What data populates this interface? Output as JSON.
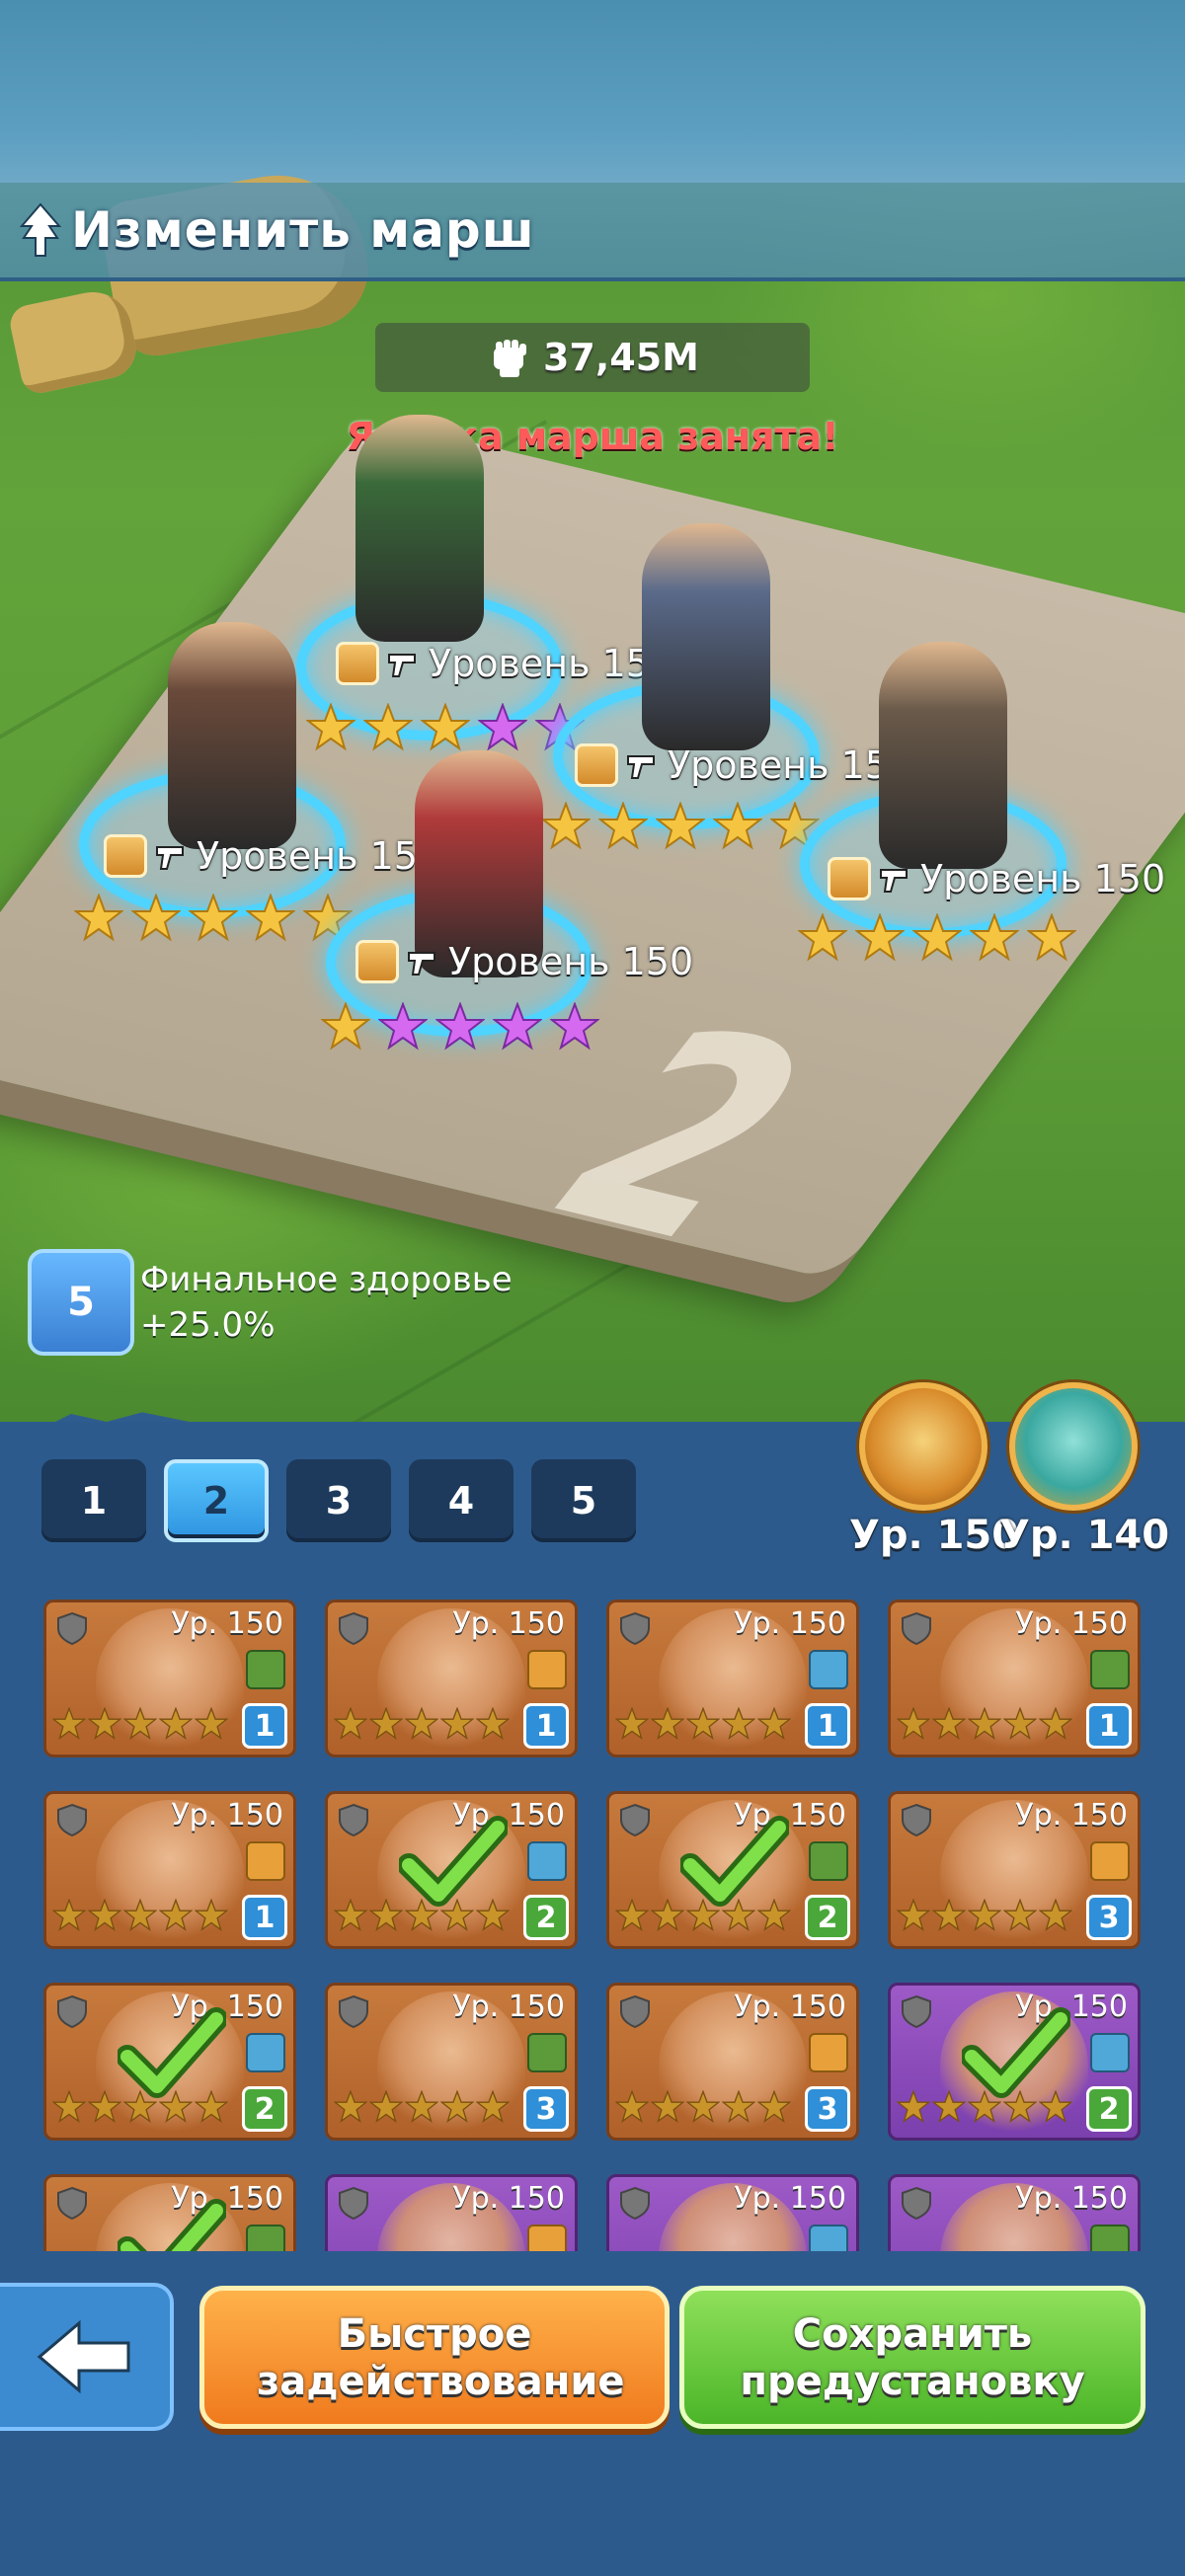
{
  "header": {
    "title": "Изменить марш",
    "power": "37,45M",
    "warning": "Ячейка марша занята!"
  },
  "formation": {
    "heroes": [
      {
        "level": "Уровень 150",
        "gold_stars": 3,
        "purple_stars": 2
      },
      {
        "level": "Уровень 150",
        "gold_stars": 5,
        "purple_stars": 0
      },
      {
        "level": "Уровень 150",
        "gold_stars": 5,
        "purple_stars": 0
      },
      {
        "level": "Уровень 150",
        "gold_stars": 5,
        "purple_stars": 0
      },
      {
        "level": "Уровень 150",
        "gold_stars": 1,
        "purple_stars": 4
      }
    ],
    "platform_number": "2"
  },
  "bonus": {
    "badge": "5",
    "label": "Финальное здоровье",
    "value": "+25.0%"
  },
  "pets": [
    {
      "level": "Ур. 150",
      "name": "eagle-pet"
    },
    {
      "level": "Ур. 140",
      "name": "dragon-pet"
    }
  ],
  "tabs": [
    {
      "label": "1",
      "active": false
    },
    {
      "label": "2",
      "active": true
    },
    {
      "label": "3",
      "active": false
    },
    {
      "label": "4",
      "active": false
    },
    {
      "label": "5",
      "active": false
    }
  ],
  "roster": [
    {
      "level": "Ур. 150",
      "count": "1",
      "selected": false,
      "purple": false
    },
    {
      "level": "Ур. 150",
      "count": "1",
      "selected": false,
      "purple": false
    },
    {
      "level": "Ур. 150",
      "count": "1",
      "selected": false,
      "purple": false
    },
    {
      "level": "Ур. 150",
      "count": "1",
      "selected": false,
      "purple": false
    },
    {
      "level": "Ур. 150",
      "count": "1",
      "selected": false,
      "purple": false
    },
    {
      "level": "Ур. 150",
      "count": "2",
      "selected": true,
      "purple": false
    },
    {
      "level": "Ур. 150",
      "count": "2",
      "selected": true,
      "purple": false
    },
    {
      "level": "Ур. 150",
      "count": "3",
      "selected": false,
      "purple": false
    },
    {
      "level": "Ур. 150",
      "count": "2",
      "selected": true,
      "purple": false
    },
    {
      "level": "Ур. 150",
      "count": "3",
      "selected": false,
      "purple": false
    },
    {
      "level": "Ур. 150",
      "count": "3",
      "selected": false,
      "purple": false
    },
    {
      "level": "Ур. 150",
      "count": "2",
      "selected": true,
      "purple": true
    },
    {
      "level": "Ур. 150",
      "count": "",
      "selected": true,
      "purple": false
    },
    {
      "level": "Ур. 150",
      "count": "",
      "selected": false,
      "purple": true
    },
    {
      "level": "Ур. 150",
      "count": "",
      "selected": false,
      "purple": true
    },
    {
      "level": "Ур. 150",
      "count": "",
      "selected": false,
      "purple": true
    }
  ],
  "buttons": {
    "back": "back-arrow-icon",
    "quick": "Быстрое задействование",
    "save": "Сохранить предустановку"
  },
  "colors": {
    "panel": "#2d5a8c",
    "ring": "#4fd3ff",
    "warning": "#ff5a5a",
    "quick_button": "#f07a1e",
    "save_button": "#4bb528"
  }
}
